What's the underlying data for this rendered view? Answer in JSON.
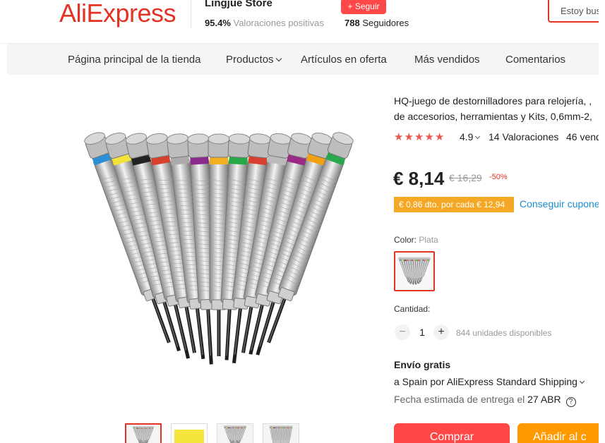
{
  "header": {
    "logo": "AliExpress",
    "store_name": "Lingjue Store",
    "follow_label": "+ Seguir",
    "positive_pct": "95.4%",
    "positive_label": "Valoraciones positivas",
    "followers_count": "788",
    "followers_label": "Seguidores",
    "search_placeholder": "Estoy bus"
  },
  "nav": {
    "items": [
      {
        "label": "Página principal de la tienda"
      },
      {
        "label": "Productos"
      },
      {
        "label": "Artículos en oferta"
      },
      {
        "label": "Más vendidos"
      },
      {
        "label": "Comentarios"
      }
    ]
  },
  "product": {
    "title_line1": "HQ-juego de destornilladores para relojería, ,",
    "title_line2": "de accesorios, herramientas y Kits, 0,6mm-2,",
    "rating": "4.9",
    "reviews": "14 Valoraciones",
    "sold": "46 vend",
    "price": "€ 8,14",
    "original_price": "€ 16,29",
    "discount": "-50%",
    "coupon_badge": "€ 0,86 dto. por cada € 12,94",
    "coupon_link": "Conseguir cupone",
    "color_label": "Color:",
    "color_value": "Plata",
    "quantity_label": "Cantidad:",
    "quantity_minus": "−",
    "quantity_plus": "+",
    "quantity_value": "1",
    "available": "844 unidades disponibles",
    "shipping_title": "Envío gratis",
    "shipping_line": "a Spain por AliExpress Standard Shipping",
    "delivery_label": "Fecha estimada de entrega el",
    "delivery_date": "27 ABR",
    "help_icon": "?",
    "buy_label": "Comprar",
    "cart_label": "Añadir al c"
  },
  "icons": {
    "star": "star-icon",
    "chevron": "chevron-down-icon",
    "help": "question-circle-icon"
  },
  "colors": {
    "brand": "#e43225",
    "buy": "#ff4747",
    "cart": "#ff9900",
    "coupon": "#f4a825",
    "link": "#1a8ccb",
    "star": "#e9584f",
    "driver_bands": [
      "#2b8fd8",
      "#f2e23a",
      "#222222",
      "#d8402e",
      "#aaaaaa",
      "#8a2a8c",
      "#f0b020",
      "#27a846",
      "#d8402e",
      "#bbbbbb",
      "#9a2a86",
      "#f0a010",
      "#2aa84c"
    ]
  }
}
